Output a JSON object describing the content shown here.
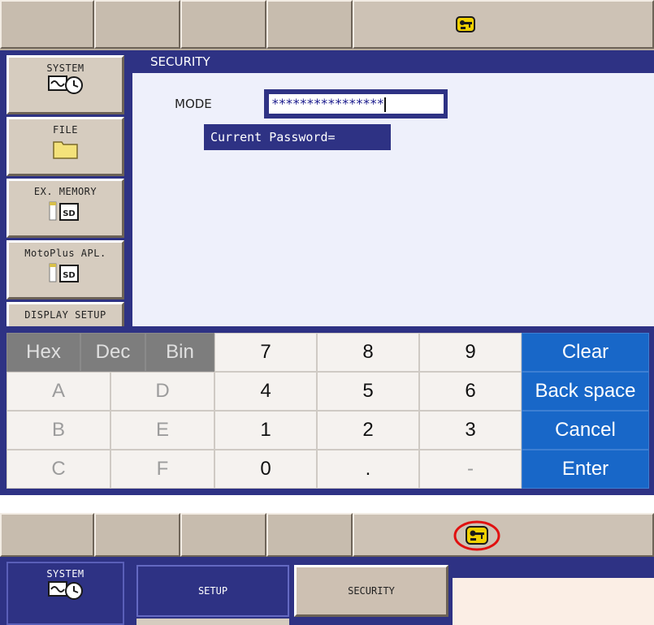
{
  "top_status": {
    "icon": "key-icon",
    "icon_color": "#f0d000"
  },
  "menu": {
    "system": "SYSTEM",
    "file": "FILE",
    "ex_memory": "EX. MEMORY",
    "motoplus": "MotoPlus APL.",
    "display_setup": "DISPLAY SETUP",
    "sd_label": "SD"
  },
  "panel": {
    "title": "SECURITY",
    "mode_label": "MODE",
    "password_value": "****************",
    "current_password_prompt": "Current Password="
  },
  "keypad": {
    "rows": [
      [
        "Hex",
        "Dec",
        "Bin",
        "7",
        "8",
        "9",
        "Clear"
      ],
      [
        "A",
        "D",
        "4",
        "5",
        "6",
        "Back space"
      ],
      [
        "B",
        "E",
        "1",
        "2",
        "3",
        "Cancel"
      ],
      [
        "C",
        "F",
        "0",
        ".",
        "-",
        "Enter"
      ]
    ]
  },
  "bottom": {
    "system": "SYSTEM",
    "setup": "SETUP",
    "security": "SECURITY",
    "highlight_color": "#e01010"
  },
  "colors": {
    "navy": "#2e3284",
    "keypad_blue": "#1867c8",
    "toolbar": "#c7bcae"
  }
}
